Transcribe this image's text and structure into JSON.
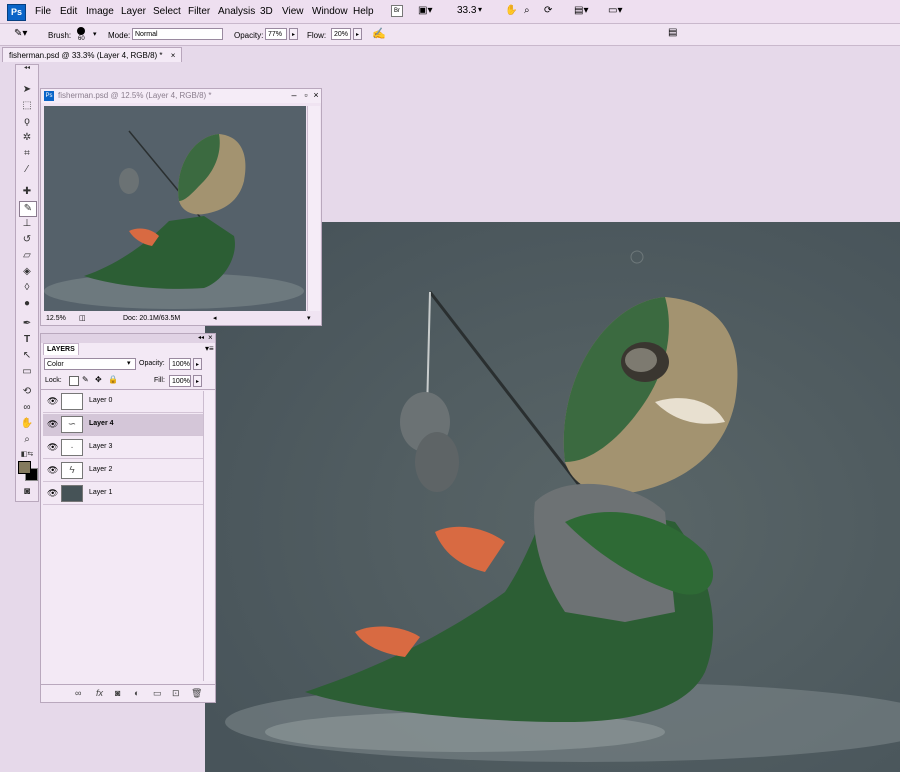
{
  "app": {
    "logo_text": "Ps"
  },
  "menu": [
    "File",
    "Edit",
    "Image",
    "Layer",
    "Select",
    "Filter",
    "Analysis",
    "3D",
    "View",
    "Window",
    "Help"
  ],
  "menubar_controls": {
    "zoom_value": "33.3"
  },
  "options": {
    "brush_label": "Brush:",
    "brush_size": "60",
    "mode_label": "Mode:",
    "mode_value": "Normal",
    "opacity_label": "Opacity:",
    "opacity_value": "77%",
    "flow_label": "Flow:",
    "flow_value": "20%"
  },
  "doc_tab": {
    "title": "fisherman.psd @ 33.3% (Layer 4, RGB/8) *",
    "close": "×"
  },
  "nav_window": {
    "title": "fisherman.psd @ 12.5% (Layer 4, RGB/8) *",
    "zoom": "12.5%",
    "doc_info": "Doc: 20.1M/63.5M"
  },
  "layers_panel": {
    "tab_label": "LAYERS",
    "blend_mode": "Color",
    "opacity_label": "Opacity:",
    "opacity_value": "100%",
    "lock_label": "Lock:",
    "fill_label": "Fill:",
    "fill_value": "100%",
    "layers": [
      {
        "name": "Layer 0",
        "active": false
      },
      {
        "name": "Layer 4",
        "active": true
      },
      {
        "name": "Layer 3",
        "active": false
      },
      {
        "name": "Layer 2",
        "active": false
      },
      {
        "name": "Layer 1",
        "active": false
      }
    ]
  },
  "colors": {
    "canvas_bg": "#4e5a5e",
    "foreground_color": "#847a5e",
    "background_color": "#000000",
    "layer1_fill": "#465357"
  }
}
